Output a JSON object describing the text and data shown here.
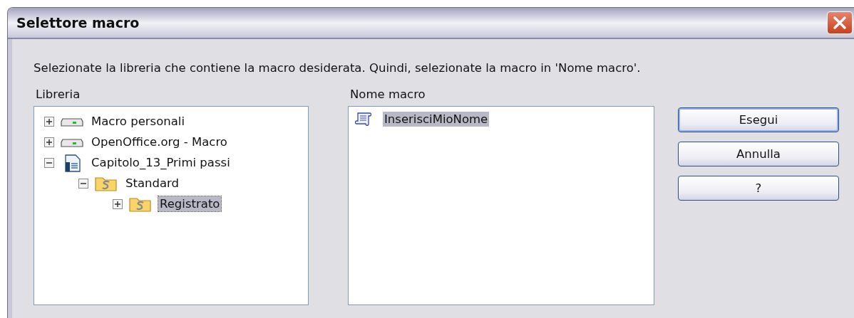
{
  "window": {
    "title": "Selettore macro"
  },
  "description": "Selezionate la libreria che contiene la macro desiderata. Quindi, selezionate la macro in 'Nome macro'.",
  "library": {
    "label": "Libreria",
    "tree": [
      {
        "kind": "drive",
        "label": "Macro personali",
        "expanded": false,
        "selected": false
      },
      {
        "kind": "drive",
        "label": "OpenOffice.org - Macro",
        "expanded": false,
        "selected": false
      },
      {
        "kind": "document",
        "label": "Capitolo_13_Primi passi",
        "expanded": true,
        "selected": false,
        "children": [
          {
            "kind": "folder",
            "label": "Standard",
            "expanded": true,
            "selected": false,
            "children": [
              {
                "kind": "folder",
                "label": "Registrato",
                "expanded": false,
                "selected": true
              }
            ]
          }
        ]
      }
    ]
  },
  "macro_name": {
    "label": "Nome macro",
    "items": [
      {
        "label": "InserisciMioNome",
        "selected": true
      }
    ]
  },
  "buttons": [
    {
      "label": "Esegui",
      "default": true
    },
    {
      "label": "Annulla",
      "default": false
    },
    {
      "label": "?",
      "default": false
    }
  ]
}
